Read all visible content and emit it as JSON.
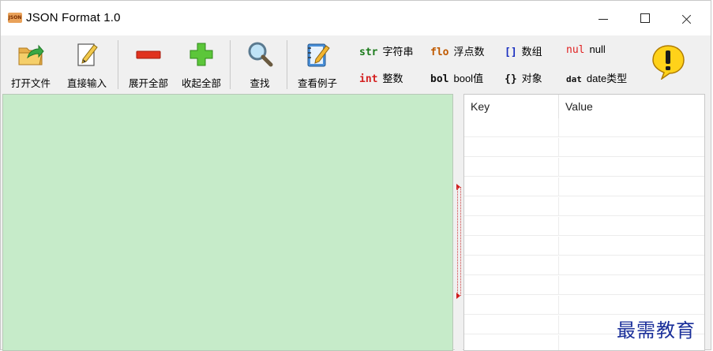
{
  "window": {
    "title": "JSON Format 1.0",
    "app_icon_text": "JSON"
  },
  "toolbar": {
    "buttons": [
      {
        "label": "打开文件",
        "icon": "open-folder-icon"
      },
      {
        "label": "直接输入",
        "icon": "edit-document-icon"
      },
      {
        "label": "展开全部",
        "icon": "minus-icon"
      },
      {
        "label": "收起全部",
        "icon": "plus-icon"
      },
      {
        "label": "查找",
        "icon": "search-icon"
      },
      {
        "label": "查看例子",
        "icon": "notebook-icon"
      }
    ],
    "legend": [
      {
        "tag": "str",
        "text": "字符串",
        "color": "#1a7a1a"
      },
      {
        "tag": "int",
        "text": "整数",
        "color": "#d42020"
      },
      {
        "tag": "flo",
        "text": "浮点数",
        "color": "#c05a00"
      },
      {
        "tag": "bol",
        "text": "bool值",
        "color": "#101010"
      },
      {
        "tag": "[]",
        "text": "数组",
        "color": "#1a2fc0"
      },
      {
        "tag": "{}",
        "text": "对象",
        "color": "#101010"
      },
      {
        "tag": "nul",
        "text": "null",
        "color": "#e02020"
      },
      {
        "tag": "dat",
        "text": "date类型",
        "color": "#101010"
      }
    ],
    "warning_icon": "warning-bubble-icon"
  },
  "colors": {
    "editor_bg": "#c6ebc9",
    "window_bg": "#f0f0f0"
  },
  "table": {
    "columns": [
      "Key",
      "Value"
    ]
  },
  "watermark": "最需教育"
}
